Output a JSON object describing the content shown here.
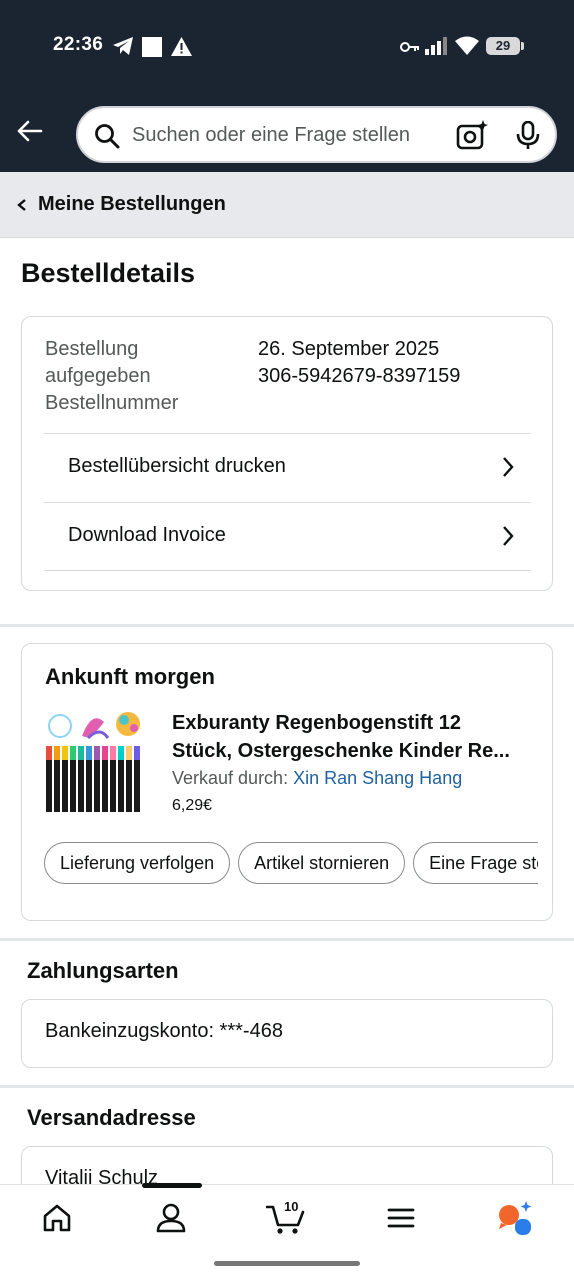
{
  "status_bar": {
    "time": "22:36",
    "battery": "29",
    "left_icons": [
      "telegram-icon",
      "square-icon",
      "warning-icon"
    ],
    "right_icons": [
      "key-icon",
      "signal-icon",
      "wifi-icon"
    ]
  },
  "search": {
    "placeholder": "Suchen oder eine Frage stellen"
  },
  "breadcrumb": {
    "label": "Meine Bestellungen"
  },
  "page": {
    "title": "Bestelldetails"
  },
  "order_info": {
    "label_line1": "Bestellung",
    "label_line2": "aufgegeben",
    "label_line3": "Bestellnummer",
    "date": "26. September 2025",
    "order_number": "306-5942679-8397159",
    "links": [
      {
        "label": "Bestellübersicht drucken"
      },
      {
        "label": "Download Invoice"
      }
    ]
  },
  "shipment": {
    "title": "Ankunft morgen",
    "product_line1": "Exburanty Regenbogenstift 12",
    "product_line2": "Stück, Ostergeschenke Kinder Re...",
    "seller_prefix": "Verkauf durch:",
    "seller_name": "Xin Ran Shang Hang",
    "price": "6,29€",
    "actions": [
      {
        "label": "Lieferung verfolgen"
      },
      {
        "label": "Artikel stornieren"
      },
      {
        "label": "Eine Frage stellen"
      }
    ]
  },
  "payment": {
    "title": "Zahlungsarten",
    "method": "Bankeinzugskonto: ***-468"
  },
  "address": {
    "title": "Versandadresse",
    "name": "Vitalii Schulz"
  },
  "bottom_nav": {
    "cart_count": "10",
    "items": [
      "home-icon",
      "account-icon",
      "cart-icon",
      "menu-icon",
      "assistant-icon"
    ],
    "active": "account-icon"
  },
  "colors": {
    "header_bg": "#1b2431",
    "link": "#2162a1",
    "breadcrumb_bg": "#e7e9ec"
  }
}
